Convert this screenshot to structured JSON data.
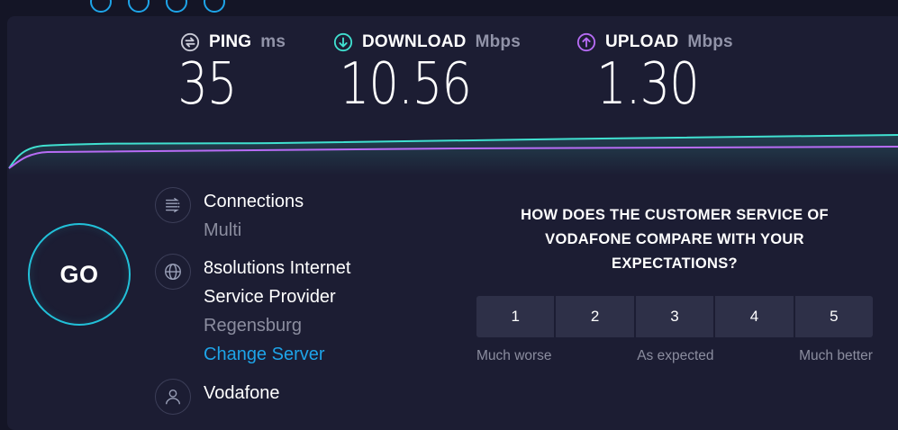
{
  "metrics": {
    "ping": {
      "label": "PING",
      "unit": "ms",
      "value": "35",
      "icon": "ping-icon",
      "color": "#c9cad6"
    },
    "download": {
      "label": "DOWNLOAD",
      "unit": "Mbps",
      "value": "10.56",
      "icon": "download-arrow-icon",
      "color": "#40e0d0"
    },
    "upload": {
      "label": "UPLOAD",
      "unit": "Mbps",
      "value": "1.30",
      "icon": "upload-arrow-icon",
      "color": "#b76cf5"
    }
  },
  "go_button": {
    "label": "GO"
  },
  "connections": {
    "title": "Connections",
    "value": "Multi",
    "icon": "connections-icon"
  },
  "server": {
    "title_line1": "8solutions Internet",
    "title_line2": "Service Provider",
    "location": "Regensburg",
    "change_link": "Change Server",
    "icon": "globe-icon"
  },
  "provider": {
    "name": "Vodafone",
    "icon": "user-icon"
  },
  "survey": {
    "question_line1": "HOW DOES THE CUSTOMER SERVICE OF",
    "question_line2": "VODAFONE COMPARE WITH YOUR",
    "question_line3": "EXPECTATIONS?",
    "options": [
      "1",
      "2",
      "3",
      "4",
      "5"
    ],
    "low_label": "Much worse",
    "mid_label": "As expected",
    "high_label": "Much better"
  },
  "colors": {
    "accent": "#1ea4e8",
    "download": "#40e0d0",
    "upload": "#b76cf5",
    "background": "#1c1d33"
  }
}
